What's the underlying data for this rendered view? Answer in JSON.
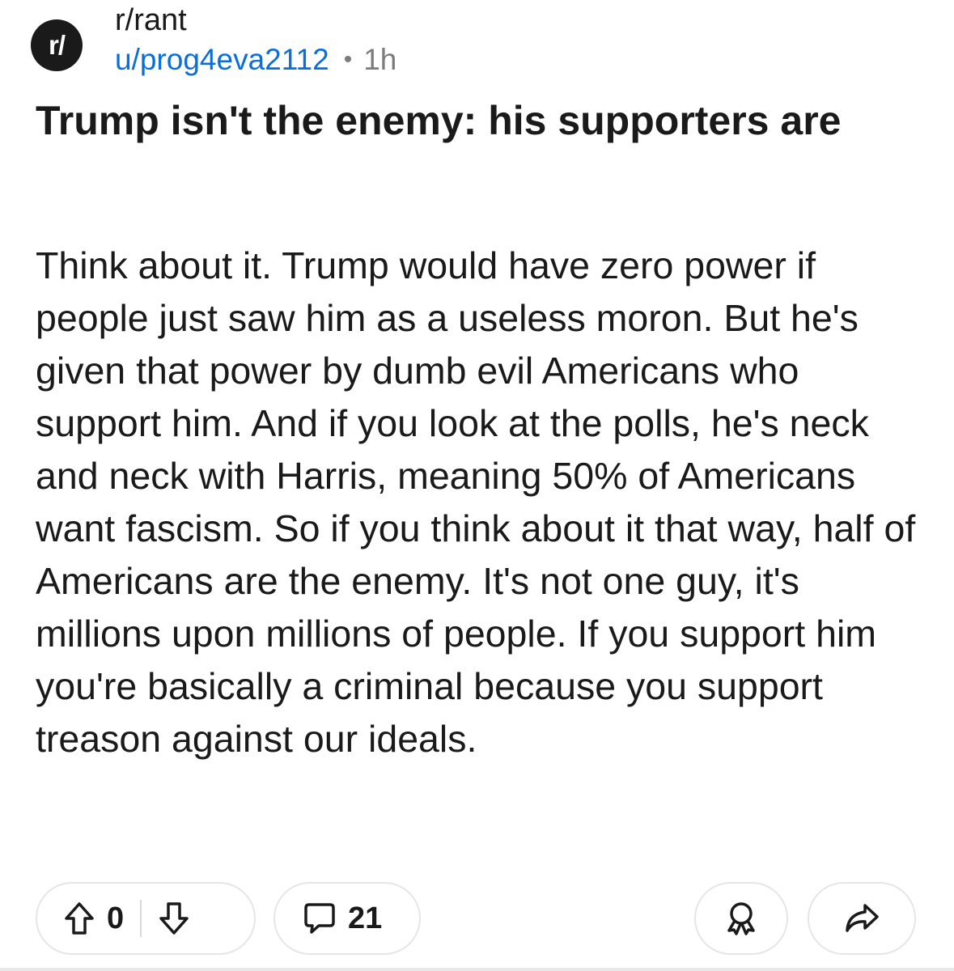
{
  "header": {
    "subreddit_avatar_text": "r/",
    "subreddit": "r/rant",
    "username": "u/prog4eva2112",
    "separator": "•",
    "age": "1h"
  },
  "post": {
    "title": "Trump isn't the enemy: his supporters are",
    "body": "Think about it. Trump would have zero power if people just saw him as a useless moron. But he's given that power by dumb evil Americans who support him. And if you look at the polls, he's neck and neck with Harris, meaning 50% of Americans want fascism. So if you think about it that way, half of Americans are the enemy. It's not one guy, it's millions upon millions of people. If you support him you're basically a criminal because you support treason against our ideals."
  },
  "actions": {
    "score": "0",
    "comment_count": "21",
    "icons": {
      "upvote": "arrow-up-icon",
      "downvote": "arrow-down-icon",
      "comments": "speech-bubble-icon",
      "award": "award-ribbon-icon",
      "share": "share-arrow-icon"
    }
  },
  "colors": {
    "text": "#1a1a1b",
    "username": "#0a6fd8",
    "muted": "#7c7c7c",
    "pill_border": "#e4e6e8"
  }
}
